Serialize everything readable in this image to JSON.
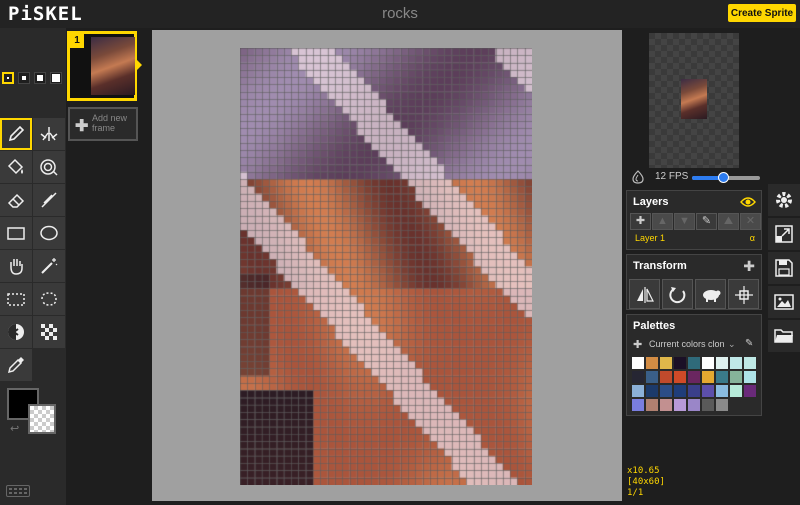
{
  "app": {
    "logo": "PiSKEL",
    "title": "rocks",
    "create_button": "Create Sprite"
  },
  "frames": {
    "items": [
      {
        "number": "1"
      }
    ],
    "add_label": "Add new frame"
  },
  "tools": [
    "pen-tool",
    "vertical-mirror-pen-tool",
    "paint-bucket-tool",
    "paint-all-same-color-tool",
    "eraser-tool",
    "stroke-tool",
    "rectangle-tool",
    "circle-tool",
    "move-tool",
    "shape-selection-tool",
    "rectangle-selection-tool",
    "lasso-selection-tool",
    "lighten-tool",
    "dithering-tool",
    "color-picker-tool"
  ],
  "active_tool": "pen-tool",
  "pen_sizes": [
    1,
    2,
    3,
    4
  ],
  "active_pen_size": 1,
  "colors": {
    "primary": "#000000",
    "secondary": "transparent",
    "accent": "#ffd700"
  },
  "preview": {
    "fps_label": "12 FPS",
    "fps": 12
  },
  "layers": {
    "title": "Layers",
    "items": [
      {
        "name": "Layer 1",
        "alpha_label": "α"
      }
    ]
  },
  "transform": {
    "title": "Transform"
  },
  "palettes": {
    "title": "Palettes",
    "selected": "Current colors clon",
    "swatches": [
      "#ffffff",
      "#d38c44",
      "#e0b84a",
      "#1b1026",
      "#2f6a7a",
      "#ffffff",
      "#dff1ef",
      "#bfe8e8",
      "#bfe9e6",
      "#262633",
      "#3a5f88",
      "#c04a2c",
      "#d04a28",
      "#6a2660",
      "#e5a930",
      "#3a7a8a",
      "#86b39a",
      "#aee3e8",
      "#8bb0d8",
      "#1c3a6a",
      "#2c4d87",
      "#1f3d7a",
      "#3a3f8a",
      "#5c4faa",
      "#8abce0",
      "#b6ead8",
      "#6a2a7a",
      "#7a7ee0",
      "#b08070",
      "#c29090",
      "#b89ad8",
      "#9a86c8",
      "#5a5a5a",
      "#8a8a8a"
    ]
  },
  "status": {
    "zoom": "x10.65",
    "size": "[40x60]",
    "frame": "1/1"
  },
  "canvas": {
    "width": 40,
    "height": 60
  }
}
